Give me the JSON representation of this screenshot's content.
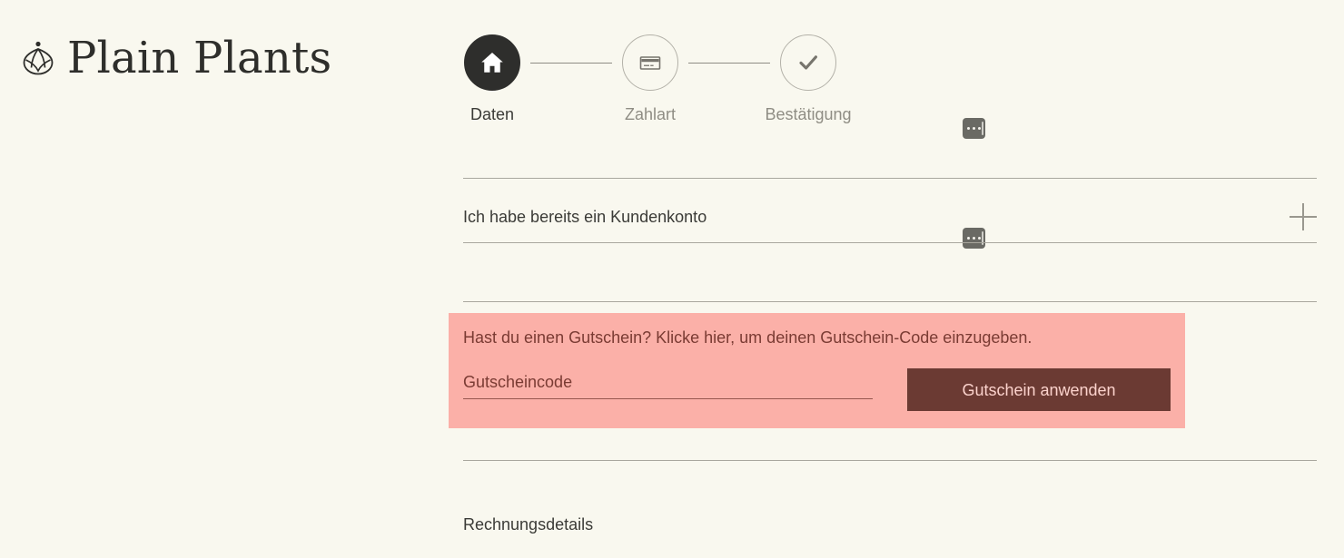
{
  "brand": {
    "name": "Plain Plants",
    "logo_icon": "plant-leaf-icon"
  },
  "stepper": {
    "steps": [
      {
        "label": "Daten",
        "icon": "home-icon",
        "state": "active"
      },
      {
        "label": "Zahlart",
        "icon": "credit-card-icon",
        "state": "inactive"
      },
      {
        "label": "Bestätigung",
        "icon": "check-icon",
        "state": "inactive"
      }
    ]
  },
  "badges": [
    {
      "name": "dots-badge-stepper",
      "glyph": "•••"
    },
    {
      "name": "dots-badge-account-row",
      "glyph": "•••"
    }
  ],
  "account": {
    "label": "Ich habe bereits ein Kundenkonto",
    "expand_icon": "plus-icon"
  },
  "coupon": {
    "hint": "Hast du einen Gutschein? Klicke hier, um deinen Gutschein-Code einzugeben.",
    "input_value": "",
    "input_placeholder": "Gutscheincode",
    "button_label": "Gutschein anwenden"
  },
  "billing": {
    "heading": "Rechnungsdetails"
  },
  "colors": {
    "page_background": "#f9f8ef",
    "text": "#3b3b37",
    "muted_text": "#8f8d84",
    "rule": "#a9a79e",
    "active_step": "#2e2e2c",
    "highlight": "#fbb0a8",
    "highlight_text": "#7a3b33",
    "button": "#6b3a33",
    "button_text": "#fbd2cc",
    "badge": "#6a6a64"
  }
}
